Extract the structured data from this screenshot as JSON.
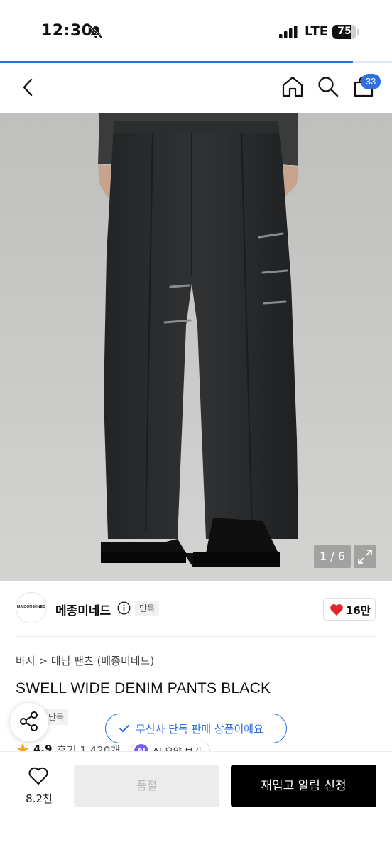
{
  "status_bar": {
    "time": "12:30",
    "network": "LTE",
    "battery": "75",
    "battery_level": 0.75
  },
  "page_load_progress": 0.9,
  "header": {
    "cart_count": "33"
  },
  "gallery": {
    "counter": "1 / 6"
  },
  "brand": {
    "logo_text": "MAISON MINED",
    "name": "메종미네드",
    "exclusive_badge": "단독",
    "like_count": "16만"
  },
  "breadcrumb": {
    "category": "바지",
    "separator": ">",
    "subcategory": "데님 팬츠 (메종미네드)"
  },
  "product": {
    "title": "SWELL WIDE DENIM PANTS BLACK",
    "exclusive_badge": "단독",
    "rating": "4.9",
    "review_label": "후기 1,420개",
    "ai_badge": "AI",
    "ai_summary_label": "AI 요약 보기"
  },
  "toast": {
    "text": "무신사 단독 판매 상품이에요"
  },
  "bottom_bar": {
    "wish_count": "8.2천",
    "soldout_label": "품절",
    "restock_label": "재입고 알림 신청"
  },
  "colors": {
    "accent": "#2f6fde",
    "heart": "#e3242b",
    "star": "#f5a623",
    "ai": "#7a5cf0"
  },
  "icons": [
    "bell-mute-icon",
    "signal-icon",
    "battery-icon",
    "chevron-left-icon",
    "home-icon",
    "search-icon",
    "cart-icon",
    "expand-icon",
    "info-icon",
    "heart-icon",
    "share-icon",
    "check-icon",
    "star-icon"
  ]
}
